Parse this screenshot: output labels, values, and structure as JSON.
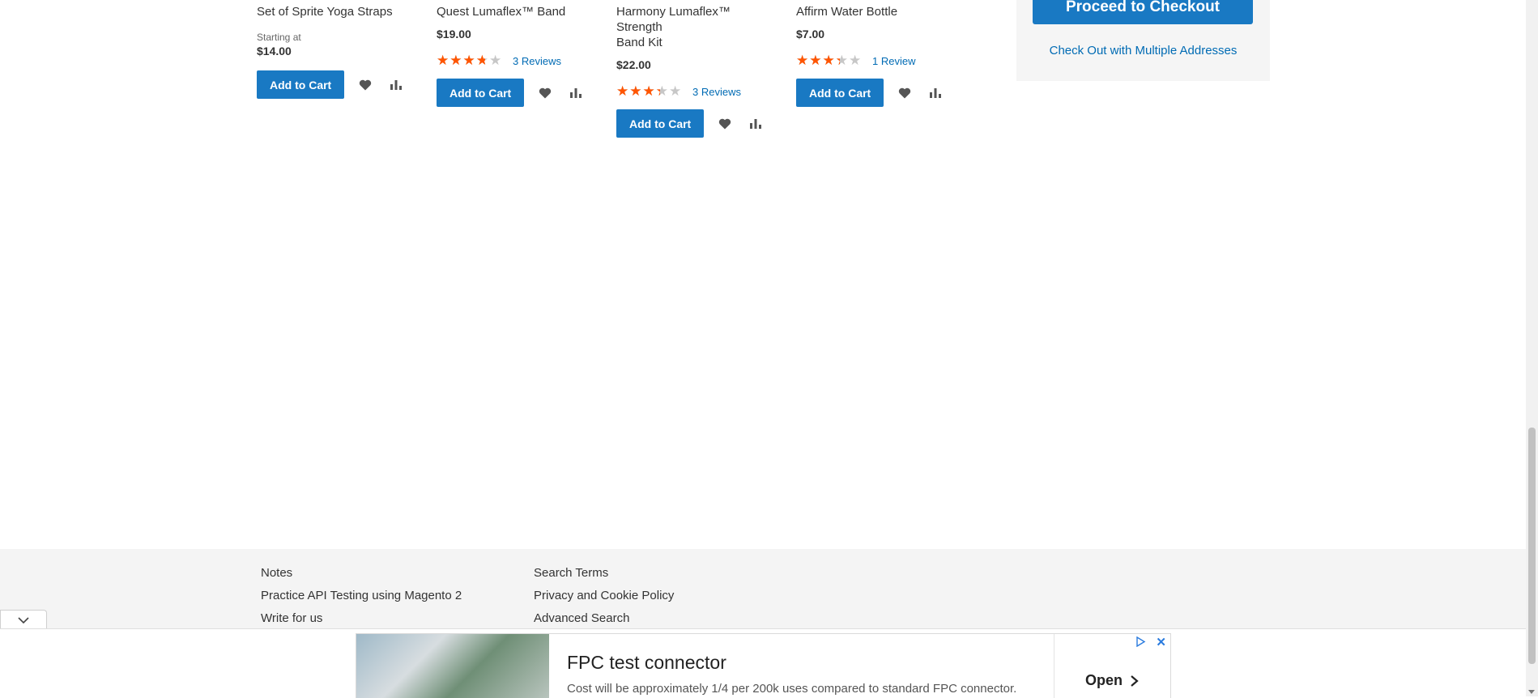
{
  "products": [
    {
      "name_lines": [
        "Set of Sprite Yoga Straps"
      ],
      "starting_label": "Starting at",
      "price": "$14.00",
      "rating": null,
      "reviews": "",
      "add_to_cart": "Add to Cart"
    },
    {
      "name_lines": [
        "Quest Lumaflex™ Band"
      ],
      "starting_label": "",
      "price": "$19.00",
      "rating": 0.67,
      "reviews": "3 Reviews",
      "add_to_cart": "Add to Cart"
    },
    {
      "name_lines": [
        "Harmony Lumaflex™ Strength",
        "Band Kit"
      ],
      "starting_label": "",
      "price": "$22.00",
      "rating": 0.6,
      "reviews": "3 Reviews",
      "add_to_cart": "Add to Cart"
    },
    {
      "name_lines": [
        "Affirm Water Bottle"
      ],
      "starting_label": "",
      "price": "$7.00",
      "rating": 0.6,
      "reviews": "1 Review",
      "add_to_cart": "Add to Cart"
    }
  ],
  "icons": {
    "wishlist": "heart-icon",
    "compare": "compare-chart-icon"
  },
  "colors": {
    "accent": "#1979c3",
    "link": "#006bb4",
    "star": "#ff5501"
  },
  "cart_summary": {
    "checkout_label": "Proceed to Checkout",
    "multi_address_label": "Check Out with Multiple Addresses"
  },
  "footer": {
    "col1": [
      "Notes",
      "Practice API Testing using Magento 2",
      "Write for us"
    ],
    "col2": [
      "Search Terms",
      "Privacy and Cookie Policy",
      "Advanced Search"
    ]
  },
  "ad": {
    "title": "FPC test connector",
    "description": "Cost will be approximately 1/4 per 200k uses compared to standard FPC connector.",
    "open_label": "Open",
    "close_label": "✕"
  }
}
